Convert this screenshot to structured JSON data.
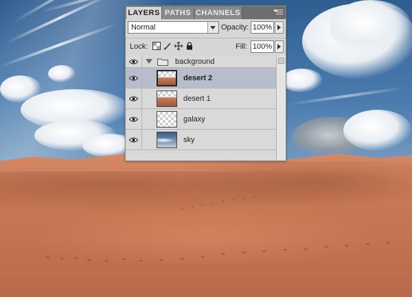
{
  "panel": {
    "tabs": [
      {
        "label": "LAYERS",
        "active": true
      },
      {
        "label": "PATHS",
        "active": false
      },
      {
        "label": "CHANNELS",
        "active": false
      }
    ],
    "blend_mode": "Normal",
    "opacity_label": "Opacity:",
    "opacity_value": "100%",
    "lock_label": "Lock:",
    "fill_label": "Fill:",
    "fill_value": "100%",
    "group": {
      "name": "background",
      "expanded": true
    },
    "layers": [
      {
        "name": "desert 2",
        "selected": true,
        "thumb": "desert"
      },
      {
        "name": "desert 1",
        "selected": false,
        "thumb": "desert"
      },
      {
        "name": "galaxy",
        "selected": false,
        "thumb": "empty"
      },
      {
        "name": "sky",
        "selected": false,
        "thumb": "sky"
      }
    ]
  },
  "colors": {
    "panel_bg": "#d6d6d6",
    "tab_bar": "#6e6e6e",
    "selected_row": "#b9bccb",
    "sand": "#c97955",
    "sky": "#4d7db0"
  }
}
